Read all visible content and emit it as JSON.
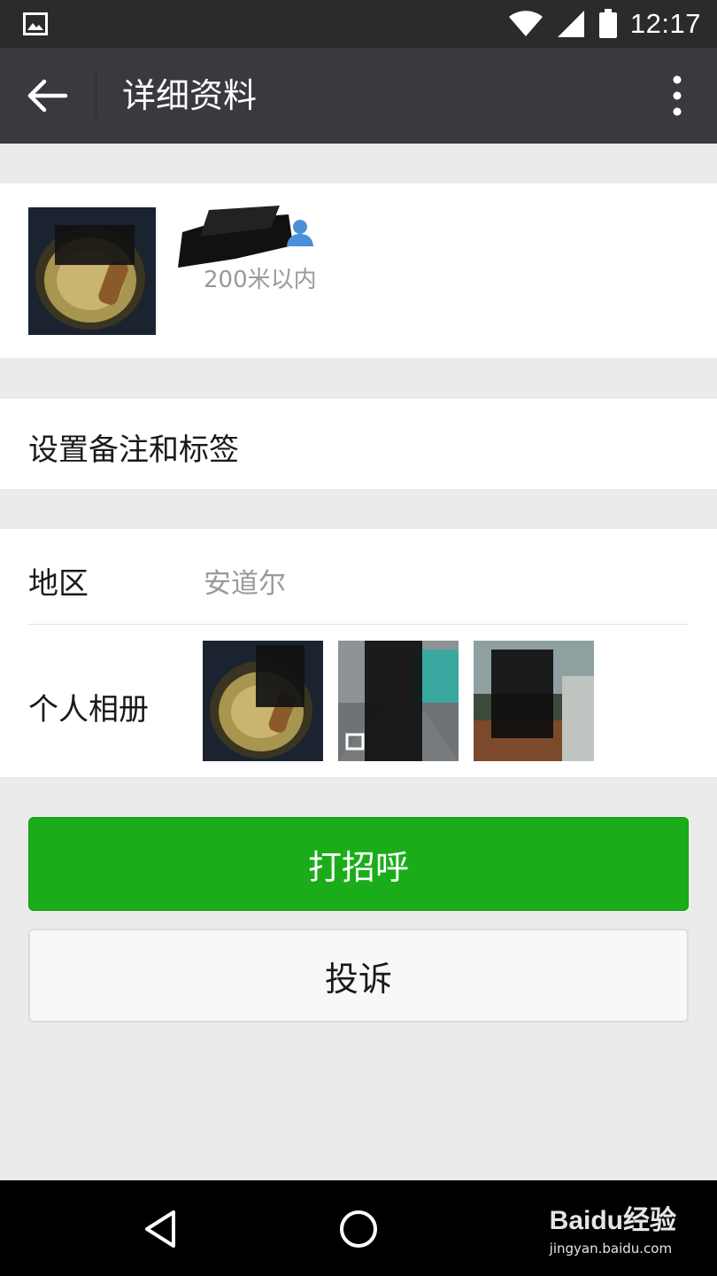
{
  "status_bar": {
    "time": "12:17",
    "icons": [
      "image-icon",
      "wifi-icon",
      "signal-icon",
      "battery-icon"
    ]
  },
  "header": {
    "title": "详细资料",
    "back_icon": "arrow-left-icon",
    "menu_icon": "more-vertical-icon"
  },
  "profile": {
    "nickname": "",
    "gender_icon": "user-icon",
    "distance": "200米以内"
  },
  "remark": {
    "label": "设置备注和标签"
  },
  "info": {
    "region_label": "地区",
    "region_value": "安道尔",
    "album_label": "个人相册"
  },
  "actions": {
    "greet_label": "打招呼",
    "report_label": "投诉"
  },
  "watermark": {
    "logo": "Baidu经验",
    "url": "jingyan.baidu.com"
  },
  "colors": {
    "accent": "#1aad19",
    "header_bg": "#393a3f",
    "page_bg": "#ebebeb"
  }
}
